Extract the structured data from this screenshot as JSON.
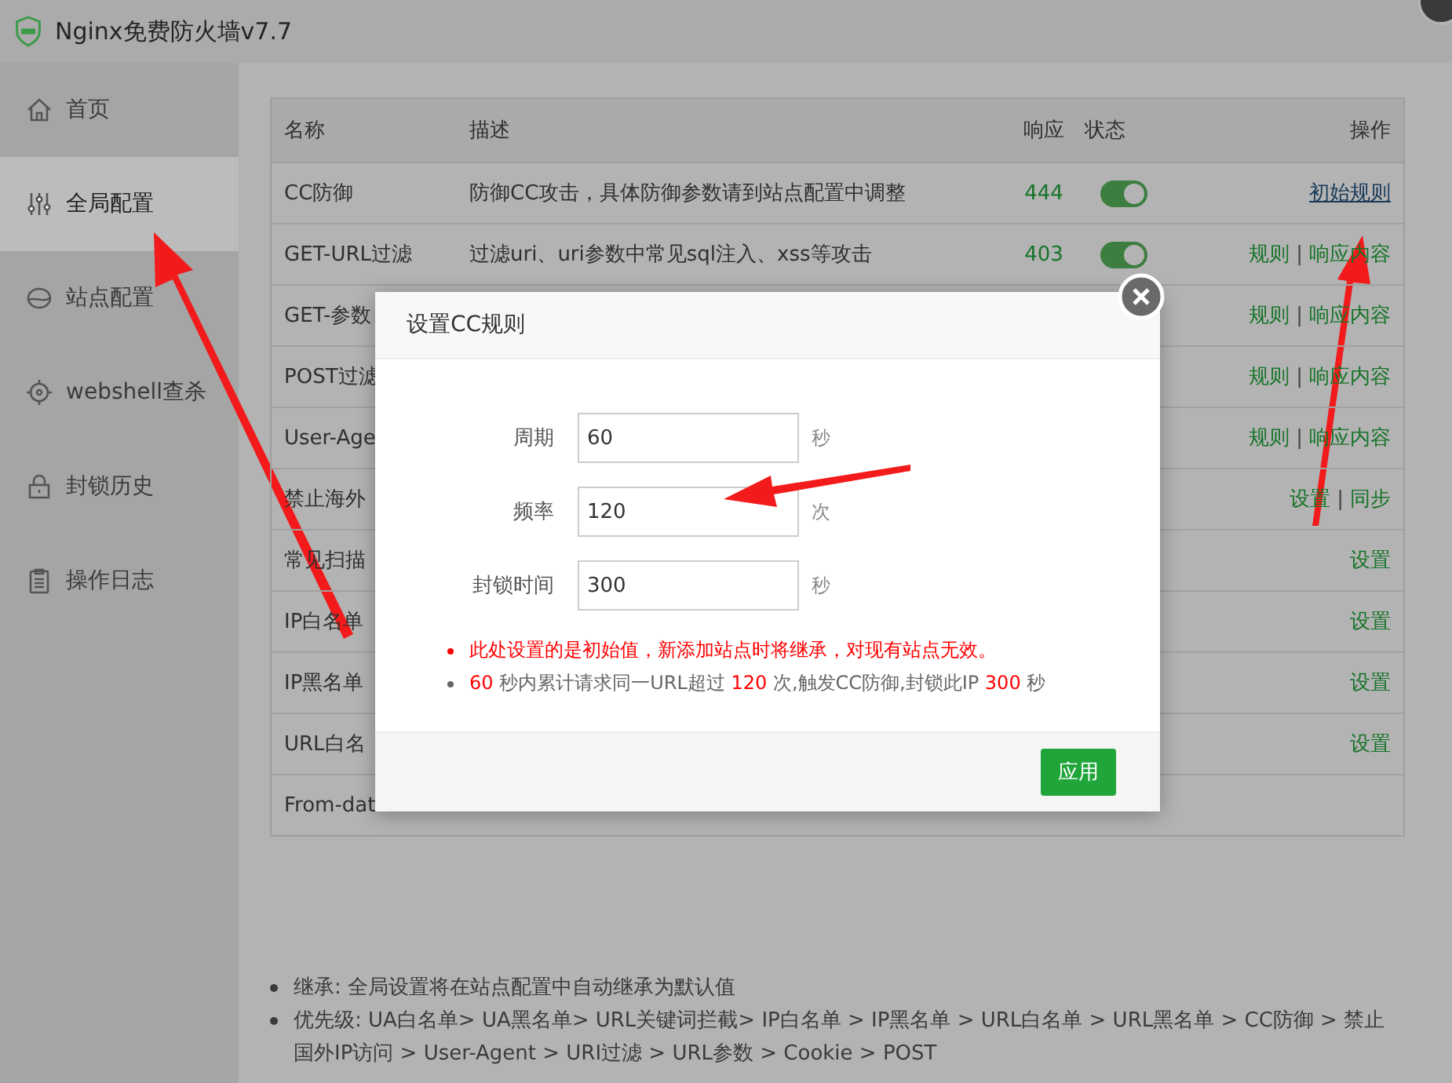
{
  "window": {
    "title": "Nginx免费防火墙v7.7"
  },
  "sidebar": {
    "items": [
      {
        "label": "首页",
        "selected": false
      },
      {
        "label": "全局配置",
        "selected": true
      },
      {
        "label": "站点配置",
        "selected": false
      },
      {
        "label": "webshell查杀",
        "selected": false
      },
      {
        "label": "封锁历史",
        "selected": false
      },
      {
        "label": "操作日志",
        "selected": false
      }
    ]
  },
  "table": {
    "columns": [
      "名称",
      "描述",
      "响应",
      "状态",
      "操作"
    ],
    "rows": [
      {
        "name": "CC防御",
        "description": "防御CC攻击，具体防御参数请到站点配置中调整",
        "response": "444",
        "toggle": {
          "on": true
        },
        "actions": [
          {
            "label": "初始规则",
            "kind": "underline"
          }
        ]
      },
      {
        "name": "GET-URL过滤",
        "description": "过滤uri、uri参数中常见sql注入、xss等攻击",
        "response": "403",
        "toggle": {
          "on": true
        },
        "actions": [
          {
            "label": "规则",
            "kind": "link"
          },
          {
            "label": "|",
            "kind": "separator"
          },
          {
            "label": "响应内容",
            "kind": "link"
          }
        ]
      },
      {
        "name": "GET-参数",
        "actions": [
          {
            "label": "规则",
            "kind": "link"
          },
          {
            "label": "|",
            "kind": "separator"
          },
          {
            "label": "响应内容",
            "kind": "link"
          }
        ]
      },
      {
        "name": "POST过滤",
        "actions": [
          {
            "label": "规则",
            "kind": "link"
          },
          {
            "label": "|",
            "kind": "separator"
          },
          {
            "label": "响应内容",
            "kind": "link"
          }
        ]
      },
      {
        "name": "User-Age",
        "actions": [
          {
            "label": "规则",
            "kind": "link"
          },
          {
            "label": "|",
            "kind": "separator"
          },
          {
            "label": "响应内容",
            "kind": "link"
          }
        ]
      },
      {
        "name": "禁止海外",
        "actions": [
          {
            "label": "设置",
            "kind": "link"
          },
          {
            "label": "|",
            "kind": "separator"
          },
          {
            "label": "同步",
            "kind": "link"
          }
        ]
      },
      {
        "name": "常见扫描",
        "actions": [
          {
            "label": "设置",
            "kind": "link"
          }
        ]
      },
      {
        "name": "IP白名单",
        "actions": [
          {
            "label": "设置",
            "kind": "link"
          }
        ]
      },
      {
        "name": "IP黑名单",
        "actions": [
          {
            "label": "设置",
            "kind": "link"
          }
        ]
      },
      {
        "name": "URL白名",
        "actions": [
          {
            "label": "设置",
            "kind": "link"
          }
        ]
      },
      {
        "name": "From-dat",
        "actions": []
      }
    ]
  },
  "notes": [
    "继承: 全局设置将在站点配置中自动继承为默认值",
    "优先级: UA白名单> UA黑名单> URL关键词拦截> IP白名单 > IP黑名单 > URL白名单 > URL黑名单 > CC防御 > 禁止国外IP访问 > User-Agent > URI过滤 > URL参数 > Cookie > POST"
  ],
  "dialog": {
    "title": "设置CC规则",
    "fields": [
      {
        "label": "周期",
        "value": "60",
        "unit": "秒"
      },
      {
        "label": "频率",
        "value": "120",
        "unit": "次"
      },
      {
        "label": "封锁时间",
        "value": "300",
        "unit": "秒"
      }
    ],
    "notes": [
      {
        "kind": "warning",
        "parts": [
          {
            "kind": "text",
            "text": "此处设置的是初始值，新添加站点时将继承，对现有站点无效。"
          }
        ]
      },
      {
        "kind": "info",
        "parts": [
          {
            "kind": "value",
            "text": "60"
          },
          {
            "kind": "text",
            "text": " 秒内累计请求同一URL超过 "
          },
          {
            "kind": "value",
            "text": "120"
          },
          {
            "kind": "text",
            "text": " 次,触发CC防御,封锁此IP "
          },
          {
            "kind": "value",
            "text": "300"
          },
          {
            "kind": "text",
            "text": " 秒"
          }
        ]
      }
    ],
    "button": "应用"
  }
}
